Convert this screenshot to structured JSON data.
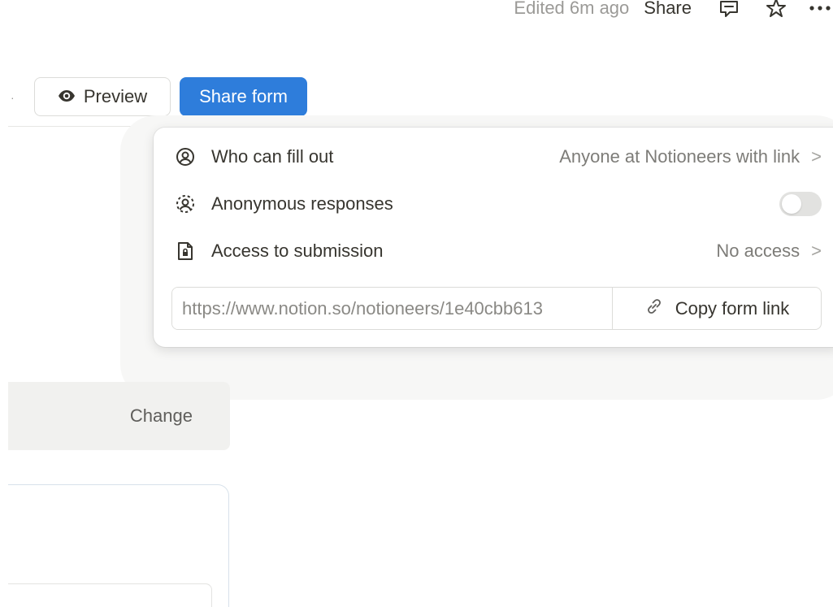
{
  "topbar": {
    "edited_text": "Edited 6m ago",
    "share_label": "Share",
    "icons": [
      "comment-icon",
      "star-icon",
      "more-icon"
    ]
  },
  "toolbar": {
    "separator": "·",
    "preview_label": "Preview",
    "preview_icon": "eye-icon",
    "share_form_label": "Share form",
    "share_form_color": "#2e7ddb"
  },
  "background": {
    "change_label": "Change"
  },
  "share_popover": {
    "rows": [
      {
        "icon": "person-circle-icon",
        "label": "Who can fill out",
        "value": "Anyone at Notioneers with link",
        "chevron": ">"
      },
      {
        "icon": "anonymous-person-icon",
        "label": "Anonymous responses",
        "toggle_on": false
      },
      {
        "icon": "locked-file-icon",
        "label": "Access to submission",
        "value": "No access",
        "chevron": ">"
      }
    ],
    "link": {
      "url": "https://www.notion.so/notioneers/1e40cbb613",
      "copy_label": "Copy form link",
      "copy_icon": "link-icon"
    }
  }
}
